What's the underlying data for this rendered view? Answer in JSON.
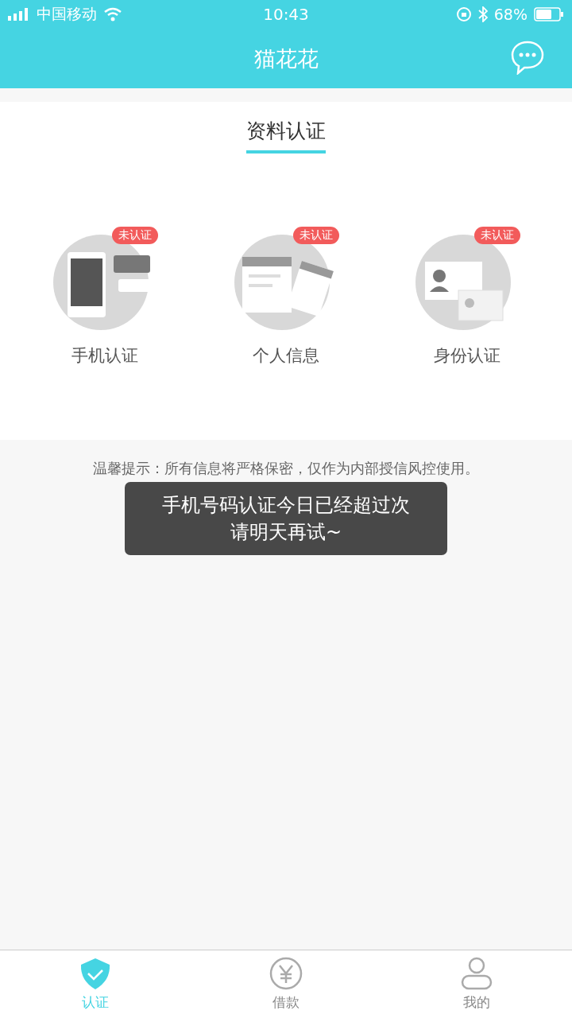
{
  "status_bar": {
    "carrier": "中国移动",
    "time": "10:43",
    "battery": "68%"
  },
  "header": {
    "title": "猫花花"
  },
  "section": {
    "title": "资料认证"
  },
  "items": [
    {
      "kind": "phone",
      "label": "手机认证",
      "badge": "未认证"
    },
    {
      "kind": "form",
      "label": "个人信息",
      "badge": "未认证"
    },
    {
      "kind": "id",
      "label": "身份认证",
      "badge": "未认证"
    }
  ],
  "tip": "温馨提示：所有信息将严格保密，仅作为内部授信风控使用。",
  "toast": {
    "lines": [
      "手机号码认证今日已经超过次",
      "请明天再试~"
    ]
  },
  "tab_bar": [
    {
      "kind": "verify",
      "label": "认证",
      "selected": true
    },
    {
      "kind": "loan",
      "label": "借款",
      "selected": false
    },
    {
      "kind": "me",
      "label": "我的",
      "selected": false
    }
  ]
}
